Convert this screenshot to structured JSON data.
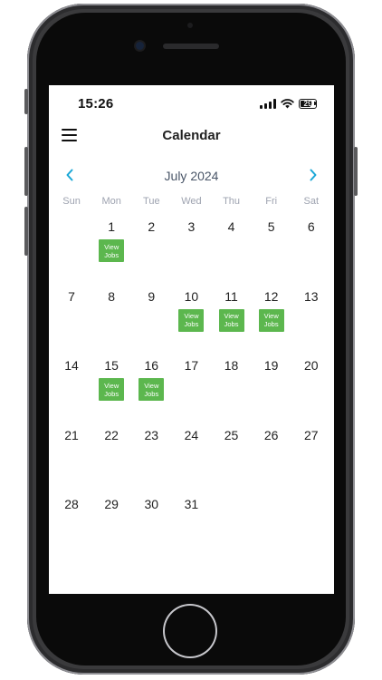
{
  "status_bar": {
    "time": "15:26",
    "battery": "29"
  },
  "header": {
    "title": "Calendar"
  },
  "month_nav": {
    "label": "July 2024"
  },
  "weekdays": [
    "Sun",
    "Mon",
    "Tue",
    "Wed",
    "Thu",
    "Fri",
    "Sat"
  ],
  "view_jobs_label": "View Jobs",
  "weeks": [
    [
      {
        "day": ""
      },
      {
        "day": "1",
        "jobs": true
      },
      {
        "day": "2"
      },
      {
        "day": "3"
      },
      {
        "day": "4"
      },
      {
        "day": "5"
      },
      {
        "day": "6"
      }
    ],
    [
      {
        "day": "7"
      },
      {
        "day": "8"
      },
      {
        "day": "9"
      },
      {
        "day": "10",
        "jobs": true
      },
      {
        "day": "11",
        "jobs": true
      },
      {
        "day": "12",
        "jobs": true
      },
      {
        "day": "13"
      }
    ],
    [
      {
        "day": "14"
      },
      {
        "day": "15",
        "jobs": true
      },
      {
        "day": "16",
        "jobs": true
      },
      {
        "day": "17"
      },
      {
        "day": "18"
      },
      {
        "day": "19"
      },
      {
        "day": "20"
      }
    ],
    [
      {
        "day": "21"
      },
      {
        "day": "22"
      },
      {
        "day": "23"
      },
      {
        "day": "24"
      },
      {
        "day": "25"
      },
      {
        "day": "26"
      },
      {
        "day": "27"
      }
    ],
    [
      {
        "day": "28"
      },
      {
        "day": "29"
      },
      {
        "day": "30"
      },
      {
        "day": "31"
      },
      {
        "day": ""
      },
      {
        "day": ""
      },
      {
        "day": ""
      }
    ]
  ],
  "colors": {
    "accent": "#1aa7d6",
    "job_badge": "#5cb74e",
    "text": "#222222",
    "muted": "#9ea3b0"
  }
}
